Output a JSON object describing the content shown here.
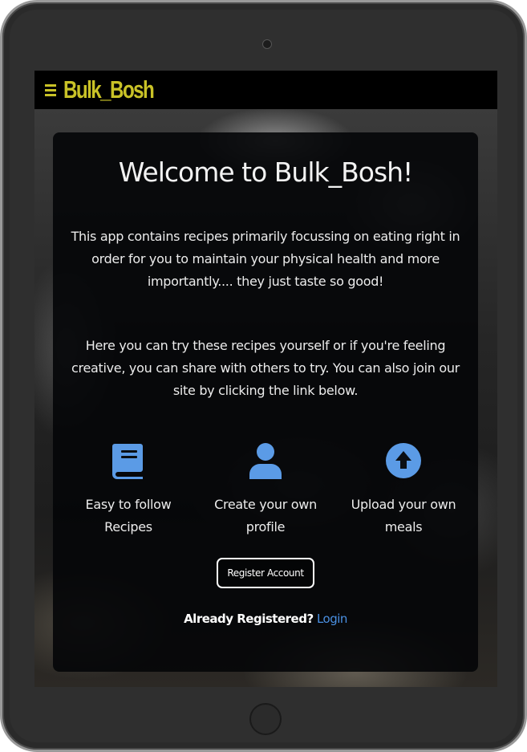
{
  "navbar": {
    "menu_icon": "hamburger-icon",
    "brand": "Bulk_Bosh",
    "brand_color": "#c9c227"
  },
  "hero": {
    "title": "Welcome to Bulk_Bosh!",
    "paragraph_1": "This app contains recipes primarily focussing on eating right in order for you to maintain your physical health and more importantly.... they just taste so good!",
    "paragraph_2": "Here you can try these recipes yourself or if you're feeling creative, you can share with others to try. You can also join our site by clicking the link below."
  },
  "features": [
    {
      "icon": "book-icon",
      "label": "Easy to follow Recipes"
    },
    {
      "icon": "user-icon",
      "label": "Create your own profile"
    },
    {
      "icon": "upload-icon",
      "label": "Upload your own meals"
    }
  ],
  "actions": {
    "register_label": "Register Account",
    "already_registered": "Already Registered?",
    "login_label": "Login"
  },
  "colors": {
    "accent": "#4a90e2",
    "icon": "#5b9be6",
    "card": "#040608"
  }
}
